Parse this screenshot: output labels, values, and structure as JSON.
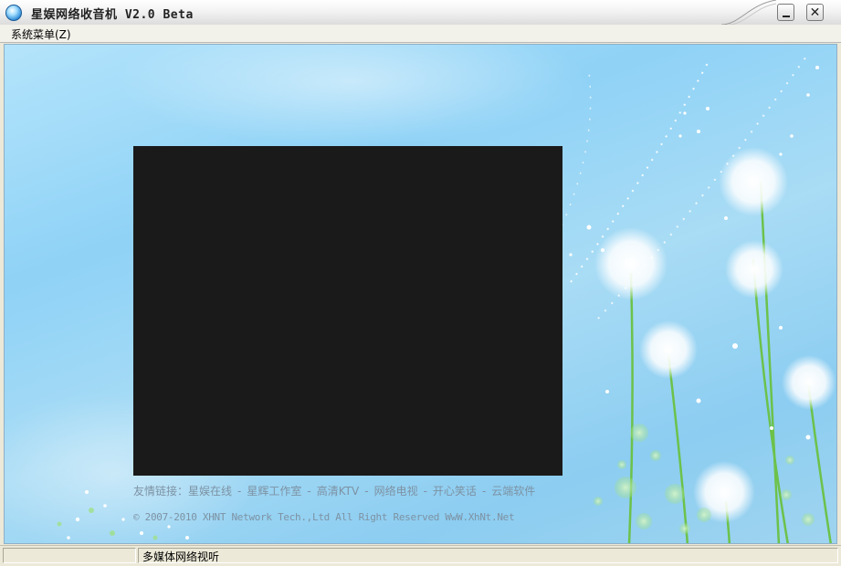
{
  "window": {
    "title": "星娱网络收音机 V2.0 Beta",
    "app_icon": "globe-icon",
    "minimize_icon": "minimize-icon",
    "close_icon": "close-icon"
  },
  "menu": {
    "items": [
      {
        "label": "系统菜单(Z)"
      }
    ]
  },
  "main": {
    "links": {
      "prefix": "友情链接：",
      "items": [
        "星娱在线",
        "星辉工作室",
        "高清KTV",
        "网络电视",
        "开心笑话",
        "云端软件"
      ],
      "separator": "-"
    },
    "copyright": "© 2007-2010 XHNT Network Tech.,Ltd All Right Reserved WwW.XhNt.Net"
  },
  "statusbar": {
    "left": "",
    "right": "多媒体网络视听"
  },
  "colors": {
    "background_sky": "#8fd2f6",
    "video_panel": "#1a1a1a",
    "link_text": "#7d92a3"
  }
}
